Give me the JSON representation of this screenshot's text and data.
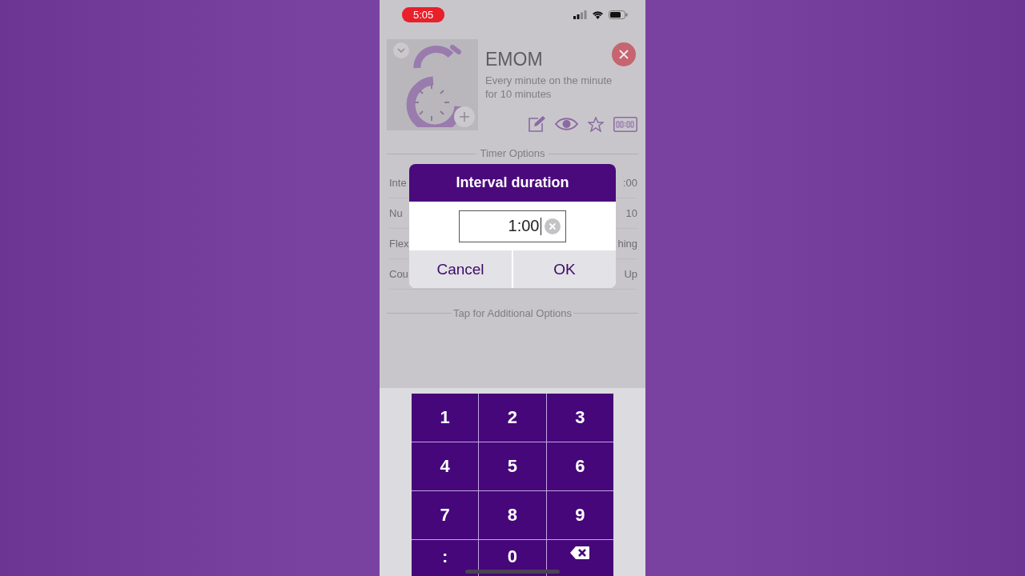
{
  "status_bar": {
    "time": "5:05"
  },
  "workout": {
    "title": "EMOM",
    "description": "Every minute on the minute for 10 minutes"
  },
  "section_header": "Timer Options",
  "rows": [
    {
      "label": "Inte",
      "value": ":00"
    },
    {
      "label": "Nu",
      "value": "10"
    },
    {
      "label": "Flex",
      "value": "hing"
    },
    {
      "label": "Cou",
      "value": "Up"
    }
  ],
  "footer_link": "Tap for Additional Options",
  "dialog": {
    "title": "Interval duration",
    "field": {
      "value": "1:00"
    },
    "buttons": [
      "Cancel",
      "OK"
    ]
  },
  "keypad": [
    {
      "kind": "text",
      "label": "1"
    },
    {
      "kind": "text",
      "label": "2"
    },
    {
      "kind": "text",
      "label": "3"
    },
    {
      "kind": "text",
      "label": "4"
    },
    {
      "kind": "text",
      "label": "5"
    },
    {
      "kind": "text",
      "label": "6"
    },
    {
      "kind": "text",
      "label": "7"
    },
    {
      "kind": "text",
      "label": "8"
    },
    {
      "kind": "text",
      "label": "9"
    },
    {
      "kind": "text",
      "label": ":"
    },
    {
      "kind": "text",
      "label": "0"
    },
    {
      "kind": "backspace"
    }
  ]
}
